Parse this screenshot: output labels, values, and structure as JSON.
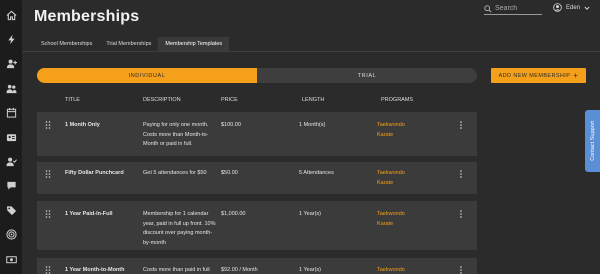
{
  "page": {
    "title": "Memberships"
  },
  "search": {
    "placeholder": "Search"
  },
  "user": {
    "name": "Eden"
  },
  "sidebar": {
    "icons": [
      "home-icon",
      "lightning-icon",
      "add-user-icon",
      "users-icon",
      "calendar-icon",
      "id-card-icon",
      "user-check-icon",
      "chat-icon",
      "tag-icon",
      "target-icon",
      "money-icon"
    ]
  },
  "tabs": [
    {
      "label": "School Memberships"
    },
    {
      "label": "Trial Memberships"
    },
    {
      "label": "Membership Templates",
      "active": true
    }
  ],
  "toggle": {
    "individual": "INDIVIDUAL",
    "trial": "TRIAL",
    "selected": "individual"
  },
  "add_button": {
    "label": "ADD NEW MEMBERSHIP",
    "icon": "plus"
  },
  "table": {
    "headers": {
      "title": "TITLE",
      "description": "DESCRIPTION",
      "price": "PRICE",
      "length": "LENGTH",
      "programs": "PROGRAMS"
    },
    "rows": [
      {
        "title": "1 Month Only",
        "desc1": "Paying for only one month.",
        "desc2": "Costs more than Month-to-",
        "desc3": "Month or paid in full.",
        "desc4": "",
        "price": "$100.00",
        "length": "1 Month(s)",
        "prog1": "Taekwondo",
        "prog2": "Karate"
      },
      {
        "title": "Fifty Dollar Punchcard",
        "desc1": "Get 5 attendances for $50",
        "desc2": "",
        "desc3": "",
        "desc4": "",
        "price": "$50.00",
        "length": "5 Attendances",
        "prog1": "Taekwondo",
        "prog2": "Karate"
      },
      {
        "title": "1 Year Paid-In-Full",
        "desc1": "Membership for 1 calendar",
        "desc2": "year, paid in full up front. 10%",
        "desc3": "discount over paying month-",
        "desc4": "by-month",
        "price": "$1,000.00",
        "length": "1 Year(s)",
        "prog1": "Taekwondo",
        "prog2": "Karate"
      },
      {
        "title": "1 Year Month-to-Month",
        "desc1": "Costs more than paid in full",
        "desc2": "",
        "desc3": "",
        "desc4": "",
        "price": "$92.00 / Month",
        "length": "1 Year(s)",
        "prog1": "Taekwondo",
        "prog2": ""
      }
    ]
  },
  "support": {
    "label": "Contact Support"
  },
  "colors": {
    "accent": "#f5a01a",
    "background": "#2b2b2b",
    "sidebar": "#1c1c1c",
    "row": "#3b3b3b",
    "support": "#5a8fd6"
  }
}
